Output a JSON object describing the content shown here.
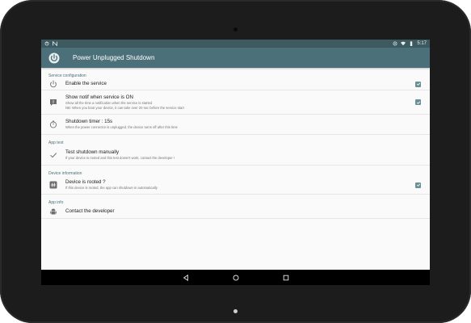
{
  "status_bar": {
    "time": "5:17",
    "left_icons": [
      "power-notification-icon",
      "notification-icon"
    ],
    "right_icons": [
      "rotate-icon",
      "wifi-icon",
      "battery-icon"
    ]
  },
  "app_bar": {
    "title": "Power Unplugged Shutdown",
    "icon": "power-icon"
  },
  "sections": [
    {
      "title": "Service configuration",
      "items": [
        {
          "icon": "power-icon",
          "title": "Enable the service",
          "summary": "",
          "checked": true
        },
        {
          "icon": "notification-icon",
          "title": "Show notif when service is ON",
          "summary": "Show all the time a notification when the service is started\nNB: When you boot your device, it can take over 20 sec before the service start",
          "checked": true
        },
        {
          "icon": "timer-icon",
          "title": "Shutdown timer : 15s",
          "summary": "When the power connector is unplugged, the device turns off after this time",
          "checked": null
        }
      ]
    },
    {
      "title": "App test",
      "items": [
        {
          "icon": "check-icon",
          "title": "Test shutdown manually",
          "summary": "If your device is rooted and this test doesn't work, contact the developer !",
          "checked": null
        }
      ]
    },
    {
      "title": "Device information",
      "items": [
        {
          "icon": "hash-icon",
          "title": "Device is rooted ?",
          "summary": "If this device is rooted, the app can shutdown in automatically",
          "checked": true
        }
      ]
    },
    {
      "title": "App info",
      "items": [
        {
          "icon": "android-icon",
          "title": "Contact the developer",
          "summary": "",
          "checked": null
        }
      ]
    }
  ],
  "nav_bar": {
    "buttons": [
      "back-icon",
      "home-icon",
      "recents-icon"
    ]
  },
  "colors": {
    "app_bar": "#4c7079",
    "status_bar": "#3c5a60",
    "accent": "#6b8f97",
    "device_frame": "#1c1c1c"
  }
}
